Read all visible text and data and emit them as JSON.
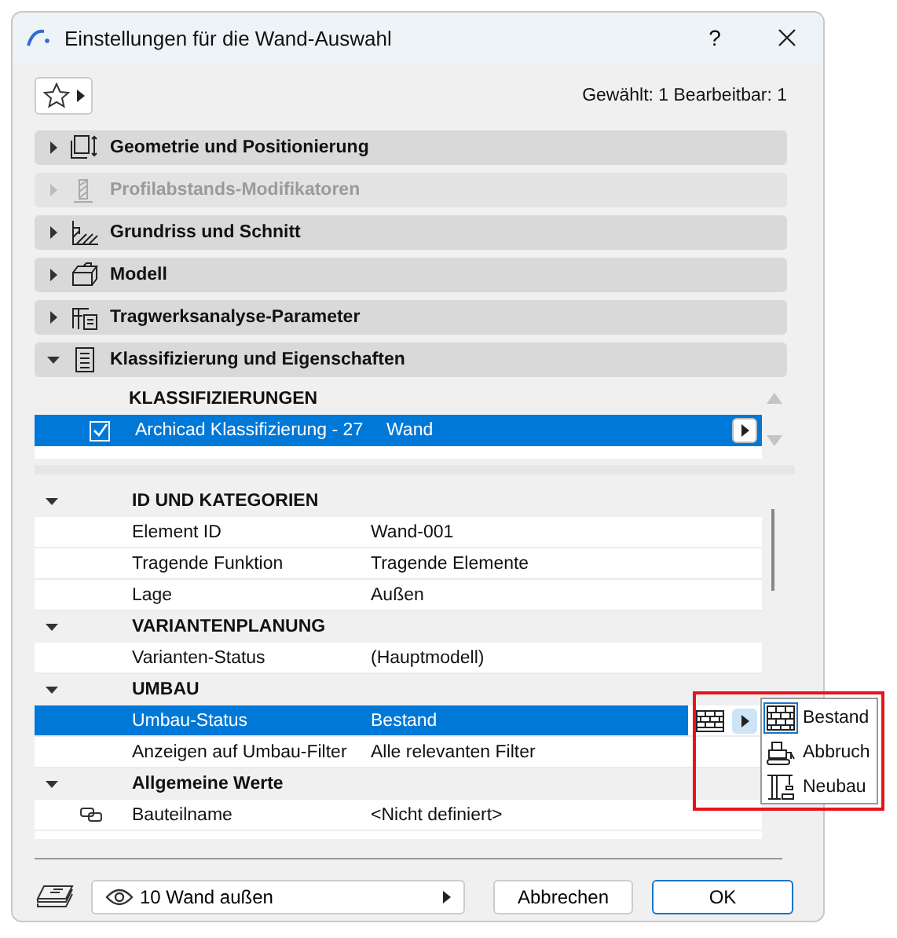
{
  "window": {
    "title": "Einstellungen für die Wand-Auswahl",
    "help": "?"
  },
  "selection_info": "Gewählt: 1 Bearbeitbar: 1",
  "sections": [
    {
      "title": "Geometrie und Positionierung",
      "kind": "geometry",
      "expanded": false,
      "disabled": false
    },
    {
      "title": "Profilabstands-Modifikatoren",
      "kind": "profile",
      "expanded": false,
      "disabled": true
    },
    {
      "title": "Grundriss und Schnitt",
      "kind": "hatch",
      "expanded": false,
      "disabled": false
    },
    {
      "title": "Modell",
      "kind": "model",
      "expanded": false,
      "disabled": false
    },
    {
      "title": "Tragwerksanalyse-Parameter",
      "kind": "structure",
      "expanded": false,
      "disabled": false
    },
    {
      "title": "Klassifizierung und Eigenschaften",
      "kind": "document",
      "expanded": true,
      "disabled": false
    }
  ],
  "classifications": {
    "header": "KLASSIFIZIERUNGEN",
    "rows": [
      {
        "name": "Archicad Klassifizierung - 27",
        "value": "Wand",
        "checked": true,
        "selected": true
      }
    ]
  },
  "properties": [
    {
      "title": "ID UND KATEGORIEN",
      "expanded": true,
      "rows": [
        {
          "label": "Element ID",
          "value": "Wand-001",
          "selected": false
        },
        {
          "label": "Tragende Funktion",
          "value": "Tragende Elemente",
          "selected": false
        },
        {
          "label": "Lage",
          "value": "Außen",
          "selected": false
        }
      ]
    },
    {
      "title": "VARIANTENPLANUNG",
      "expanded": true,
      "rows": [
        {
          "label": "Varianten-Status",
          "value": "(Hauptmodell)",
          "selected": false
        }
      ]
    },
    {
      "title": "UMBAU",
      "expanded": true,
      "rows": [
        {
          "label": "Umbau-Status",
          "value": "Bestand",
          "selected": true,
          "kind": "status"
        },
        {
          "label": "Anzeigen auf Umbau-Filter",
          "value": "Alle relevanten Filter",
          "selected": false
        }
      ]
    },
    {
      "title": "Allgemeine Werte",
      "expanded": true,
      "rows": [
        {
          "label": "Bauteilname",
          "value": "<Nicht definiert>",
          "selected": false,
          "kind": "link"
        }
      ]
    }
  ],
  "status_menu": {
    "items": [
      {
        "label": "Bestand",
        "kind": "brick",
        "selected": true
      },
      {
        "label": "Abbruch",
        "kind": "demolish",
        "selected": false
      },
      {
        "label": "Neubau",
        "kind": "crane",
        "selected": false
      }
    ]
  },
  "footer": {
    "layer": "10 Wand außen",
    "buttons": [
      {
        "label": "Abbrechen",
        "default": false
      },
      {
        "label": "OK",
        "default": true
      }
    ]
  }
}
